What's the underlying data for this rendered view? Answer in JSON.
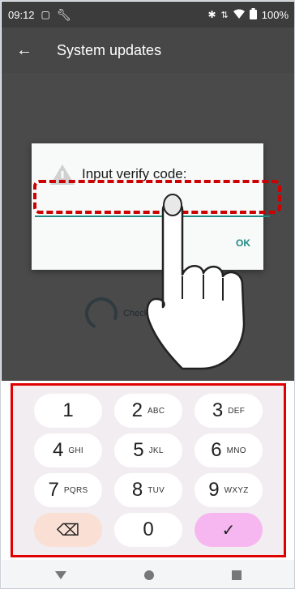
{
  "status_bar": {
    "time": "09:12",
    "battery": "100%",
    "icons": [
      "sim-icon",
      "wrench-icon",
      "bluetooth-icon",
      "data-arrows-icon",
      "wifi-icon",
      "battery-icon"
    ]
  },
  "app_bar": {
    "title": "System updates",
    "back_icon": "arrow-left-icon"
  },
  "content": {
    "status_text": "Check"
  },
  "dialog": {
    "title": "Input verify code:",
    "input_value": "",
    "ok_label": "OK",
    "accent_color": "#1f8a84"
  },
  "keypad": {
    "keys": [
      {
        "digit": "1",
        "letters": ""
      },
      {
        "digit": "2",
        "letters": "ABC"
      },
      {
        "digit": "3",
        "letters": "DEF"
      },
      {
        "digit": "4",
        "letters": "GHI"
      },
      {
        "digit": "5",
        "letters": "JKL"
      },
      {
        "digit": "6",
        "letters": "MNO"
      },
      {
        "digit": "7",
        "letters": "PQRS"
      },
      {
        "digit": "8",
        "letters": "TUV"
      },
      {
        "digit": "9",
        "letters": "WXYZ"
      }
    ],
    "zero": "0",
    "backspace_symbol": "⌫",
    "enter_symbol": "✓",
    "highlight_color": "#e00000"
  }
}
